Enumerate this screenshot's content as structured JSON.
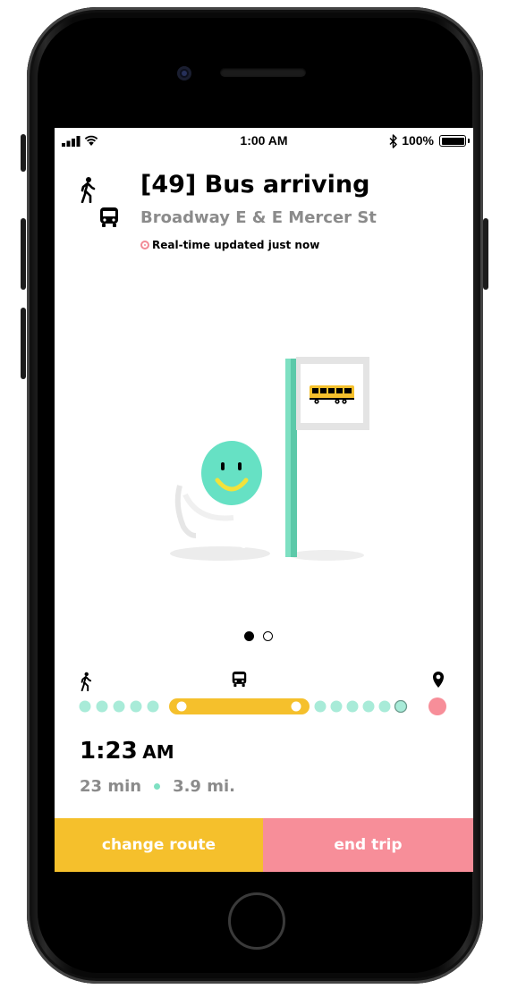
{
  "status_bar": {
    "time": "1:00 AM",
    "battery": "100%"
  },
  "trip": {
    "title": "[49] Bus arriving",
    "stop": "Broadway E & E Mercer St",
    "realtime": "Real-time updated just now"
  },
  "pager": {
    "count": 2,
    "active_index": 0
  },
  "timeline": {
    "walk_dots_before_bus": 5,
    "dots_after_bus": 6,
    "colors": {
      "walk": "#a8ebd8",
      "bus": "#f5c02c",
      "destination": "#f78e99",
      "last_stop_outline": "#6a9a8c"
    }
  },
  "eta": {
    "time": "1:23",
    "ampm": "AM",
    "duration": "23 min",
    "distance": "3.9 mi."
  },
  "actions": {
    "change_route": "change route",
    "end_trip": "end trip"
  },
  "colors": {
    "accent_yellow": "#f5c02c",
    "accent_pink": "#f78e99",
    "accent_mint": "#7ee0c2",
    "secondary_text": "#8b8b8b"
  }
}
